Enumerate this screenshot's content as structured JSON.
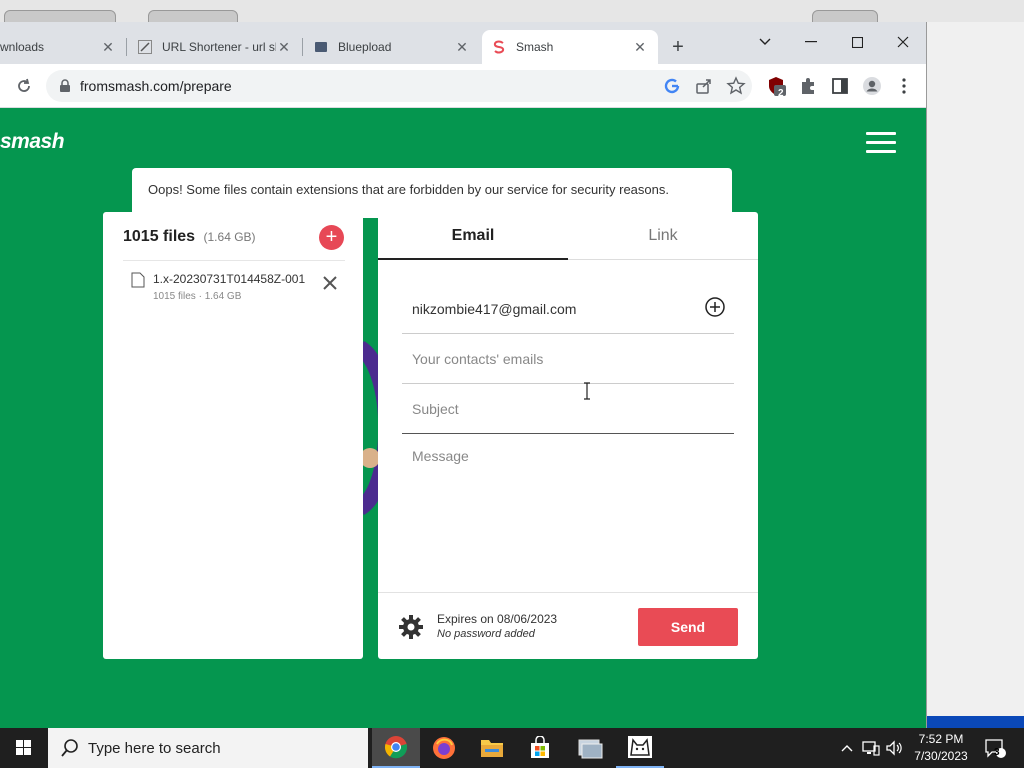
{
  "browser": {
    "tabs": [
      {
        "label": "wnloads",
        "icon": "downloads-icon"
      },
      {
        "label": "URL Shortener - url sh",
        "icon": "url-shortener-favicon"
      },
      {
        "label": "Blueplоad",
        "icon": "blueplоad-favicon"
      },
      {
        "label": "Smash",
        "icon": "smash-favicon",
        "active": true
      }
    ],
    "url": "fromsmash.com/prepare",
    "extension_badge": "2"
  },
  "page": {
    "logo": "smash",
    "notice": "Oops! Some files contain extensions that are forbidden by our service for security reasons.",
    "files": {
      "count_label": "1015 files",
      "size_label": "(1.64 GB)",
      "items": [
        {
          "name": "1.x-20230731T014458Z-001",
          "meta": "1015 files · 1.64 GB"
        }
      ]
    },
    "transfer": {
      "tab_email": "Email",
      "tab_link": "Link",
      "sender_email": "nikzombie417@gmail.com",
      "contacts_placeholder": "Your contacts' emails",
      "subject_placeholder": "Subject",
      "message_placeholder": "Message",
      "expires": "Expires on 08/06/2023",
      "password_status": "No password added",
      "send_label": "Send"
    }
  },
  "taskbar": {
    "search_placeholder": "Type here to search",
    "time": "7:52 PM",
    "date": "7/30/2023",
    "notification_count": "3"
  },
  "colors": {
    "smash_green": "#05964f",
    "accent_red": "#e94b55"
  }
}
